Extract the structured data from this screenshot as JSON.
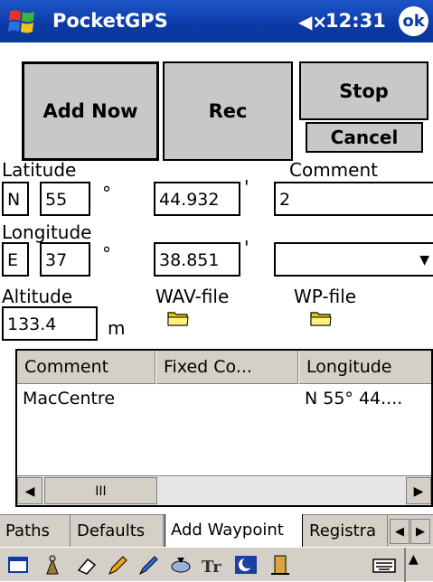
{
  "titlebar": {
    "app_title": "PocketGPS",
    "speaker_icon": "speaker-muted-icon",
    "speaker_symbol": "◀×",
    "time": "12:31",
    "ok_label": "ok",
    "start_icon": "windows-flag-icon"
  },
  "buttons": {
    "add_now": "Add Now",
    "rec": "Rec",
    "stop": "Stop",
    "cancel": "Cancel"
  },
  "form": {
    "latitude_label": "Latitude",
    "lat_hemisphere": "N",
    "lat_degrees": "55",
    "degree_symbol": "°",
    "lat_minutes": "44.932",
    "minute_symbol": "'",
    "comment_label": "Comment",
    "comment_value": "2",
    "longitude_label": "Longitude",
    "lon_hemisphere": "E",
    "lon_degrees": "37",
    "lon_minutes": "38.851",
    "dropdown_value": "",
    "dropdown_arrow": "▼",
    "altitude_label": "Altitude",
    "altitude_value": "133.4",
    "altitude_unit": "m",
    "wav_label": "WAV-file",
    "wp_label": "WP-file"
  },
  "list": {
    "columns": [
      "Comment",
      "Fixed Co...",
      "Longitude"
    ],
    "rows": [
      {
        "comment": "MacCentre",
        "fixed": "",
        "longitude": "N 55° 44...."
      }
    ],
    "scroll_left": "◀",
    "scroll_right": "▶",
    "thumb_grip": "III"
  },
  "tabs": {
    "items": [
      "Paths",
      "Defaults",
      "Add Waypoint",
      "Registra"
    ],
    "active": "Add Waypoint",
    "prev": "◀",
    "next": "▶"
  },
  "taskbar": {
    "icons": [
      "window-icon",
      "tools-icon",
      "eraser-icon",
      "pencil-icon",
      "pen-icon",
      "disk-icon",
      "text-icon",
      "moon-icon",
      "door-icon",
      "keyboard-icon",
      "up-arrow-icon"
    ],
    "keyboard_arrow": "▲"
  },
  "colors": {
    "titlebar": "#0b3aa6",
    "button_face": "#c8c8c8",
    "chrome": "#d4d0c8",
    "folder": "#e6d200"
  }
}
